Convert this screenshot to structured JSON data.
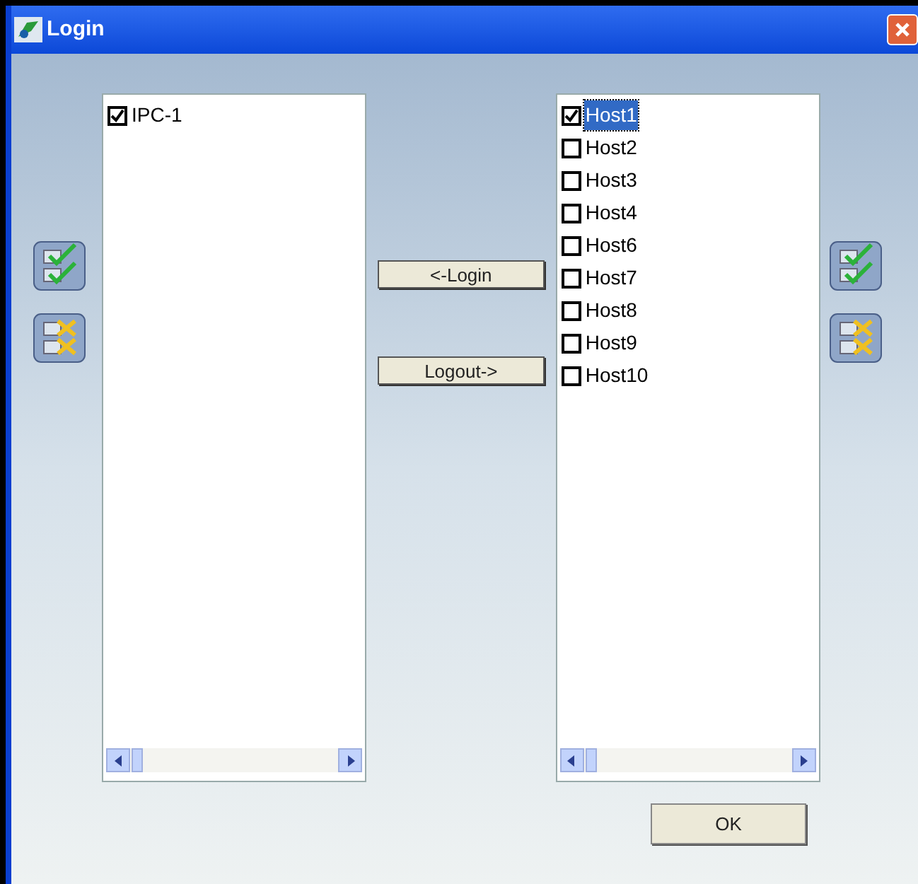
{
  "window": {
    "title": "Login"
  },
  "left_list": {
    "items": [
      {
        "label": "IPC-1",
        "checked": true,
        "selected": false
      }
    ]
  },
  "right_list": {
    "items": [
      {
        "label": "Host1",
        "checked": true,
        "selected": true
      },
      {
        "label": "Host2",
        "checked": false,
        "selected": false
      },
      {
        "label": "Host3",
        "checked": false,
        "selected": false
      },
      {
        "label": "Host4",
        "checked": false,
        "selected": false
      },
      {
        "label": "Host6",
        "checked": false,
        "selected": false
      },
      {
        "label": "Host7",
        "checked": false,
        "selected": false
      },
      {
        "label": "Host8",
        "checked": false,
        "selected": false
      },
      {
        "label": "Host9",
        "checked": false,
        "selected": false
      },
      {
        "label": "Host10",
        "checked": false,
        "selected": false
      }
    ]
  },
  "middle_buttons": [
    "<-Login",
    "Logout->"
  ],
  "ok_button": "OK"
}
